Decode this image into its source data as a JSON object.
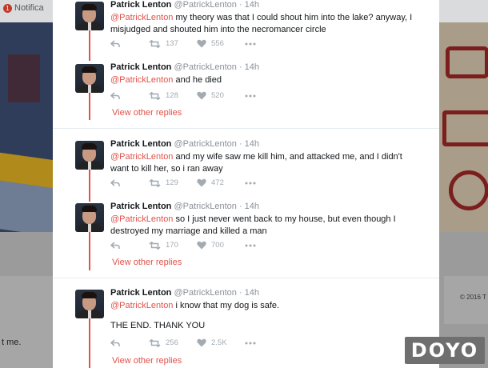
{
  "background": {
    "notifications_label": "Notifica",
    "notifications_badge": "1",
    "left_snippet": "t me.",
    "right_snippet": "© 2016 T"
  },
  "tweets": [
    {
      "name": "Patrick Lenton",
      "handle": "@PatrickLenton · 14h",
      "mention": "@PatrickLenton",
      "text": " my theory was that I could shout him into the lake? anyway, I misjudged and shouted him into the necromancer circle",
      "retweets": "137",
      "likes": "556"
    },
    {
      "name": "Patrick Lenton",
      "handle": "@PatrickLenton · 14h",
      "mention": "@PatrickLenton",
      "text": " and he died",
      "retweets": "128",
      "likes": "520"
    },
    {
      "name": "Patrick Lenton",
      "handle": "@PatrickLenton · 14h",
      "mention": "@PatrickLenton",
      "text": " and my wife saw me kill him, and attacked me, and I didn't want to kill her, so i ran away",
      "retweets": "129",
      "likes": "472"
    },
    {
      "name": "Patrick Lenton",
      "handle": "@PatrickLenton · 14h",
      "mention": "@PatrickLenton",
      "text": " so I just never went back to my house, but even though I destroyed my marriage and killed a man",
      "retweets": "170",
      "likes": "700"
    },
    {
      "name": "Patrick Lenton",
      "handle": "@PatrickLenton · 14h",
      "mention": "@PatrickLenton",
      "text": " i know that my dog is safe.",
      "text2": "THE END. THANK YOU",
      "retweets": "256",
      "likes": "2.5K"
    }
  ],
  "view_other_replies": "View other replies",
  "watermark": "DOYO",
  "colors": {
    "accent": "#e0524a",
    "muted": "#8a9099",
    "text": "#14171a"
  },
  "icons": [
    "reply-icon",
    "retweet-icon",
    "like-icon",
    "more-icon"
  ]
}
